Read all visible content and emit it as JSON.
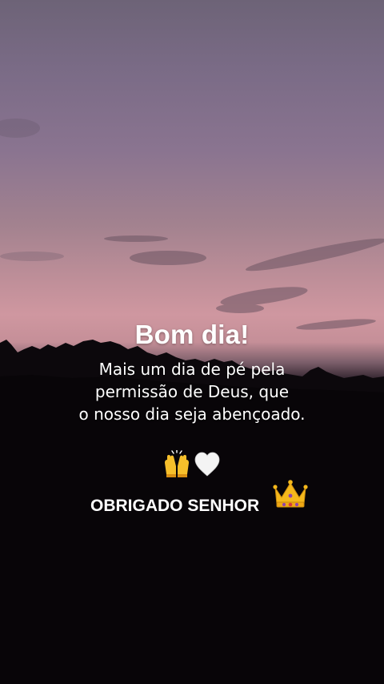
{
  "post": {
    "greeting": "Bom dia!",
    "message_lines": [
      "Mais um dia de pé pela",
      "permissão de Deus, que",
      "o nosso dia seja abençoado."
    ],
    "emojis": [
      "raising-hands-icon",
      "white-heart-icon"
    ],
    "closing": "OBRIGADO SENHOR",
    "closing_emoji": "crown-icon"
  },
  "colors": {
    "sky_top": "#6d6377",
    "sky_horizon": "#cf97a0",
    "foreground": "#050305",
    "text": "#ffffff"
  }
}
